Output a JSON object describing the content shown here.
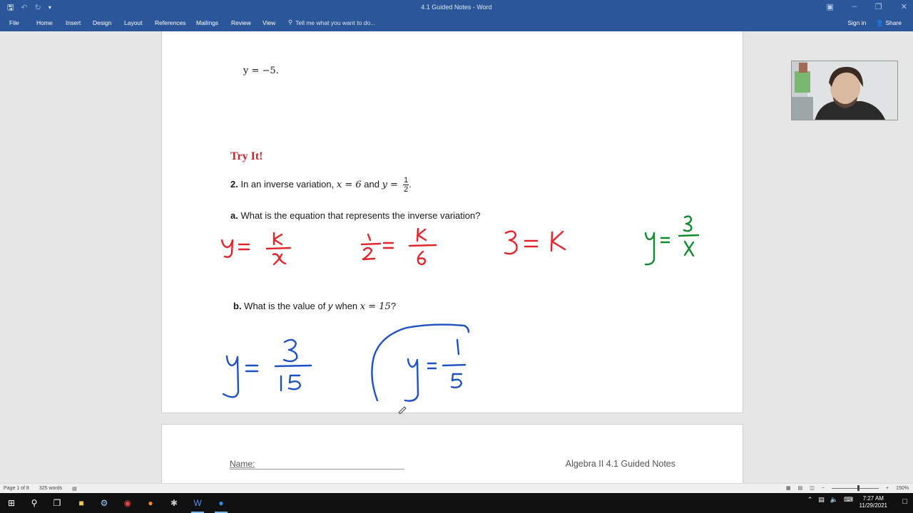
{
  "window": {
    "title": "4.1 Guided Notes - Word",
    "save_icon": "save-icon",
    "undo_icon": "undo-icon",
    "redo_icon": "redo-icon"
  },
  "ribbon": {
    "tabs": [
      "File",
      "Home",
      "Insert",
      "Design",
      "Layout",
      "References",
      "Mailings",
      "Review",
      "View"
    ],
    "tell_me": "Tell me what you want to do...",
    "sign_in": "Sign in",
    "share": "Share"
  },
  "document": {
    "prev_answer": "y = −5.",
    "try_it": "Try It!",
    "question": {
      "number": "2.",
      "text_before": " In an inverse variation, ",
      "x_value": "x = 6",
      "and": " and ",
      "y_lhs": "y = ",
      "frac_num": "1",
      "frac_den": "2",
      "end": "."
    },
    "part_a": {
      "label": "a.",
      "text": " What is the equation that represents the inverse variation?"
    },
    "part_b": {
      "label": "b.",
      "text_before": " What is the value of ",
      "var": "y",
      "text_mid": " when ",
      "cond": "x = 15",
      "end": "?"
    },
    "ink": {
      "red_color": "#e0262c",
      "green_color": "#138a2e",
      "blue_color": "#1f51c4"
    },
    "next_page": {
      "name_label": "Name:",
      "header_right": "Algebra II 4.1 Guided Notes"
    }
  },
  "status": {
    "page": "Page 1 of 8",
    "words": "325 words",
    "zoom": "150%"
  },
  "taskbar": {
    "time": "7:27 AM",
    "date": "11/29/2021"
  }
}
